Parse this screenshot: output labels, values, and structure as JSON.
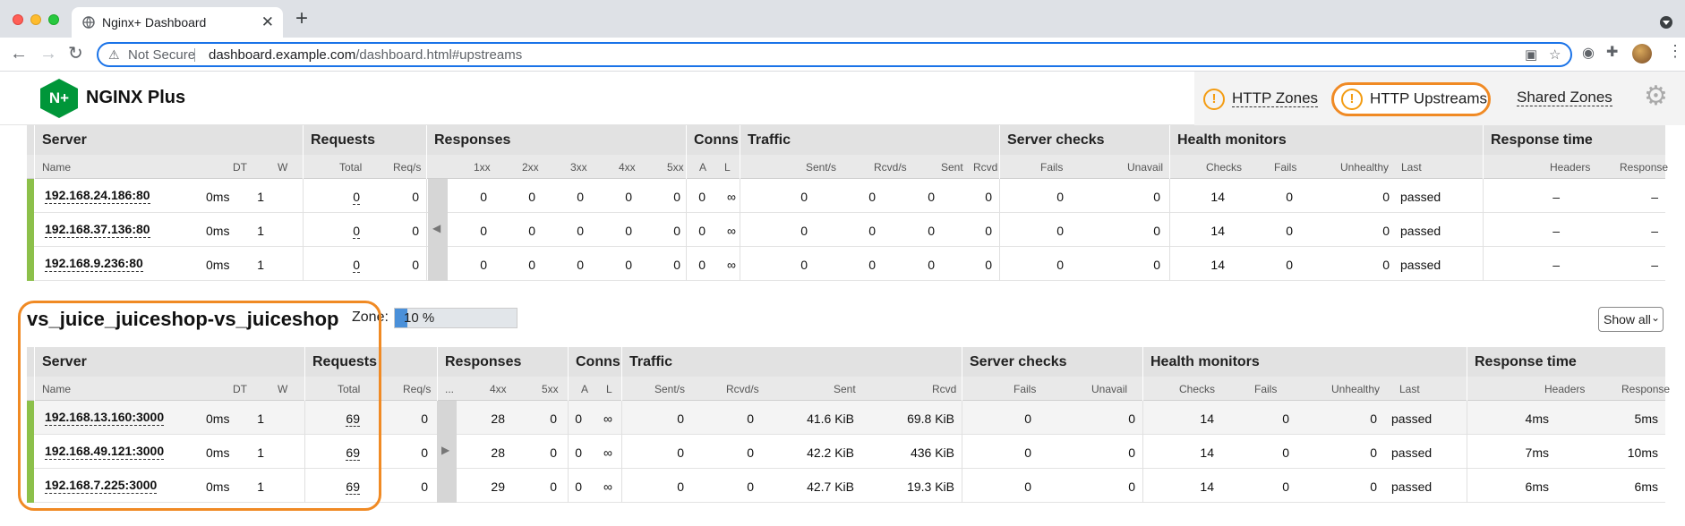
{
  "browser": {
    "tab_title": "Nginx+ Dashboard",
    "close_glyph": "✕",
    "new_tab_glyph": "+",
    "not_secure": "Not Secure",
    "url_host": "dashboard.example.com",
    "url_path": "/dashboard.html#upstreams"
  },
  "app": {
    "logo_mark": "N+",
    "logo_text": "NGINX Plus",
    "nav": {
      "zones": "HTTP Zones",
      "upstreams": "HTTP Upstreams",
      "shared": "Shared Zones",
      "warn": "!"
    }
  },
  "table_headers": {
    "server": "Server",
    "requests": "Requests",
    "responses": "Responses",
    "conns": "Conns",
    "traffic": "Traffic",
    "server_checks": "Server checks",
    "health_monitors": "Health monitors",
    "response_time": "Response time",
    "name": "Name",
    "dt": "DT",
    "w": "W",
    "total": "Total",
    "req_s": "Req/s",
    "r1xx": "1xx",
    "r2xx": "2xx",
    "r3xx": "3xx",
    "r4xx": "4xx",
    "r5xx": "5xx",
    "a": "A",
    "l": "L",
    "sent_s": "Sent/s",
    "rcvd_s": "Rcvd/s",
    "sent": "Sent",
    "rcvd": "Rcvd",
    "fails": "Fails",
    "unavail": "Unavail",
    "checks": "Checks",
    "unhealthy": "Unhealthy",
    "last": "Last",
    "headers": "Headers",
    "response": "Response",
    "ellipsis": "..."
  },
  "upstream1": {
    "rows": [
      {
        "server": "192.168.24.186:80",
        "dt": "0ms",
        "w": "1",
        "total": "0",
        "req_s": "0",
        "r1": "0",
        "r2": "0",
        "r3": "0",
        "r4": "0",
        "r5": "0",
        "a": "0",
        "l": "∞",
        "sent_s": "0",
        "rcvd_s": "0",
        "sent": "0",
        "rcvd": "0",
        "fails": "0",
        "unavail": "0",
        "checks": "14",
        "hfails": "0",
        "unhealthy": "0",
        "last": "passed",
        "headers": "–",
        "response": "–"
      },
      {
        "server": "192.168.37.136:80",
        "dt": "0ms",
        "w": "1",
        "total": "0",
        "req_s": "0",
        "r1": "0",
        "r2": "0",
        "r3": "0",
        "r4": "0",
        "r5": "0",
        "a": "0",
        "l": "∞",
        "sent_s": "0",
        "rcvd_s": "0",
        "sent": "0",
        "rcvd": "0",
        "fails": "0",
        "unavail": "0",
        "checks": "14",
        "hfails": "0",
        "unhealthy": "0",
        "last": "passed",
        "headers": "–",
        "response": "–"
      },
      {
        "server": "192.168.9.236:80",
        "dt": "0ms",
        "w": "1",
        "total": "0",
        "req_s": "0",
        "r1": "0",
        "r2": "0",
        "r3": "0",
        "r4": "0",
        "r5": "0",
        "a": "0",
        "l": "∞",
        "sent_s": "0",
        "rcvd_s": "0",
        "sent": "0",
        "rcvd": "0",
        "fails": "0",
        "unavail": "0",
        "checks": "14",
        "hfails": "0",
        "unhealthy": "0",
        "last": "passed",
        "headers": "–",
        "response": "–"
      }
    ]
  },
  "upstream2": {
    "name": "vs_juice_juiceshop-vs_juiceshop",
    "zone_label": "Zone:",
    "zone_percent": "10 %",
    "zone_fill_fraction": 0.1,
    "show_all": "Show all",
    "rows": [
      {
        "server": "192.168.13.160:3000",
        "dt": "0ms",
        "w": "1",
        "total": "69",
        "req_s": "0",
        "r4": "28",
        "r5": "0",
        "a": "0",
        "l": "∞",
        "sent_s": "0",
        "rcvd_s": "0",
        "sent": "41.6 KiB",
        "rcvd": "69.8 KiB",
        "fails": "0",
        "unavail": "0",
        "checks": "14",
        "hfails": "0",
        "unhealthy": "0",
        "last": "passed",
        "headers": "4ms",
        "response": "5ms"
      },
      {
        "server": "192.168.49.121:3000",
        "dt": "0ms",
        "w": "1",
        "total": "69",
        "req_s": "0",
        "r4": "28",
        "r5": "0",
        "a": "0",
        "l": "∞",
        "sent_s": "0",
        "rcvd_s": "0",
        "sent": "42.2 KiB",
        "rcvd": "436 KiB",
        "fails": "0",
        "unavail": "0",
        "checks": "14",
        "hfails": "0",
        "unhealthy": "0",
        "last": "passed",
        "headers": "7ms",
        "response": "10ms"
      },
      {
        "server": "192.168.7.225:3000",
        "dt": "0ms",
        "w": "1",
        "total": "69",
        "req_s": "0",
        "r4": "29",
        "r5": "0",
        "a": "0",
        "l": "∞",
        "sent_s": "0",
        "rcvd_s": "0",
        "sent": "42.7 KiB",
        "rcvd": "19.3 KiB",
        "fails": "0",
        "unavail": "0",
        "checks": "14",
        "hfails": "0",
        "unhealthy": "0",
        "last": "passed",
        "headers": "6ms",
        "response": "6ms"
      }
    ]
  },
  "colors": {
    "accent": "#f08a24",
    "healthy": "#8cc04a",
    "brand": "#009639"
  },
  "icons": [
    "globe-icon",
    "back-icon",
    "forward-icon",
    "reload-icon",
    "warning-icon",
    "qr-icon",
    "star-icon",
    "extensions-icon",
    "gear-icon"
  ]
}
